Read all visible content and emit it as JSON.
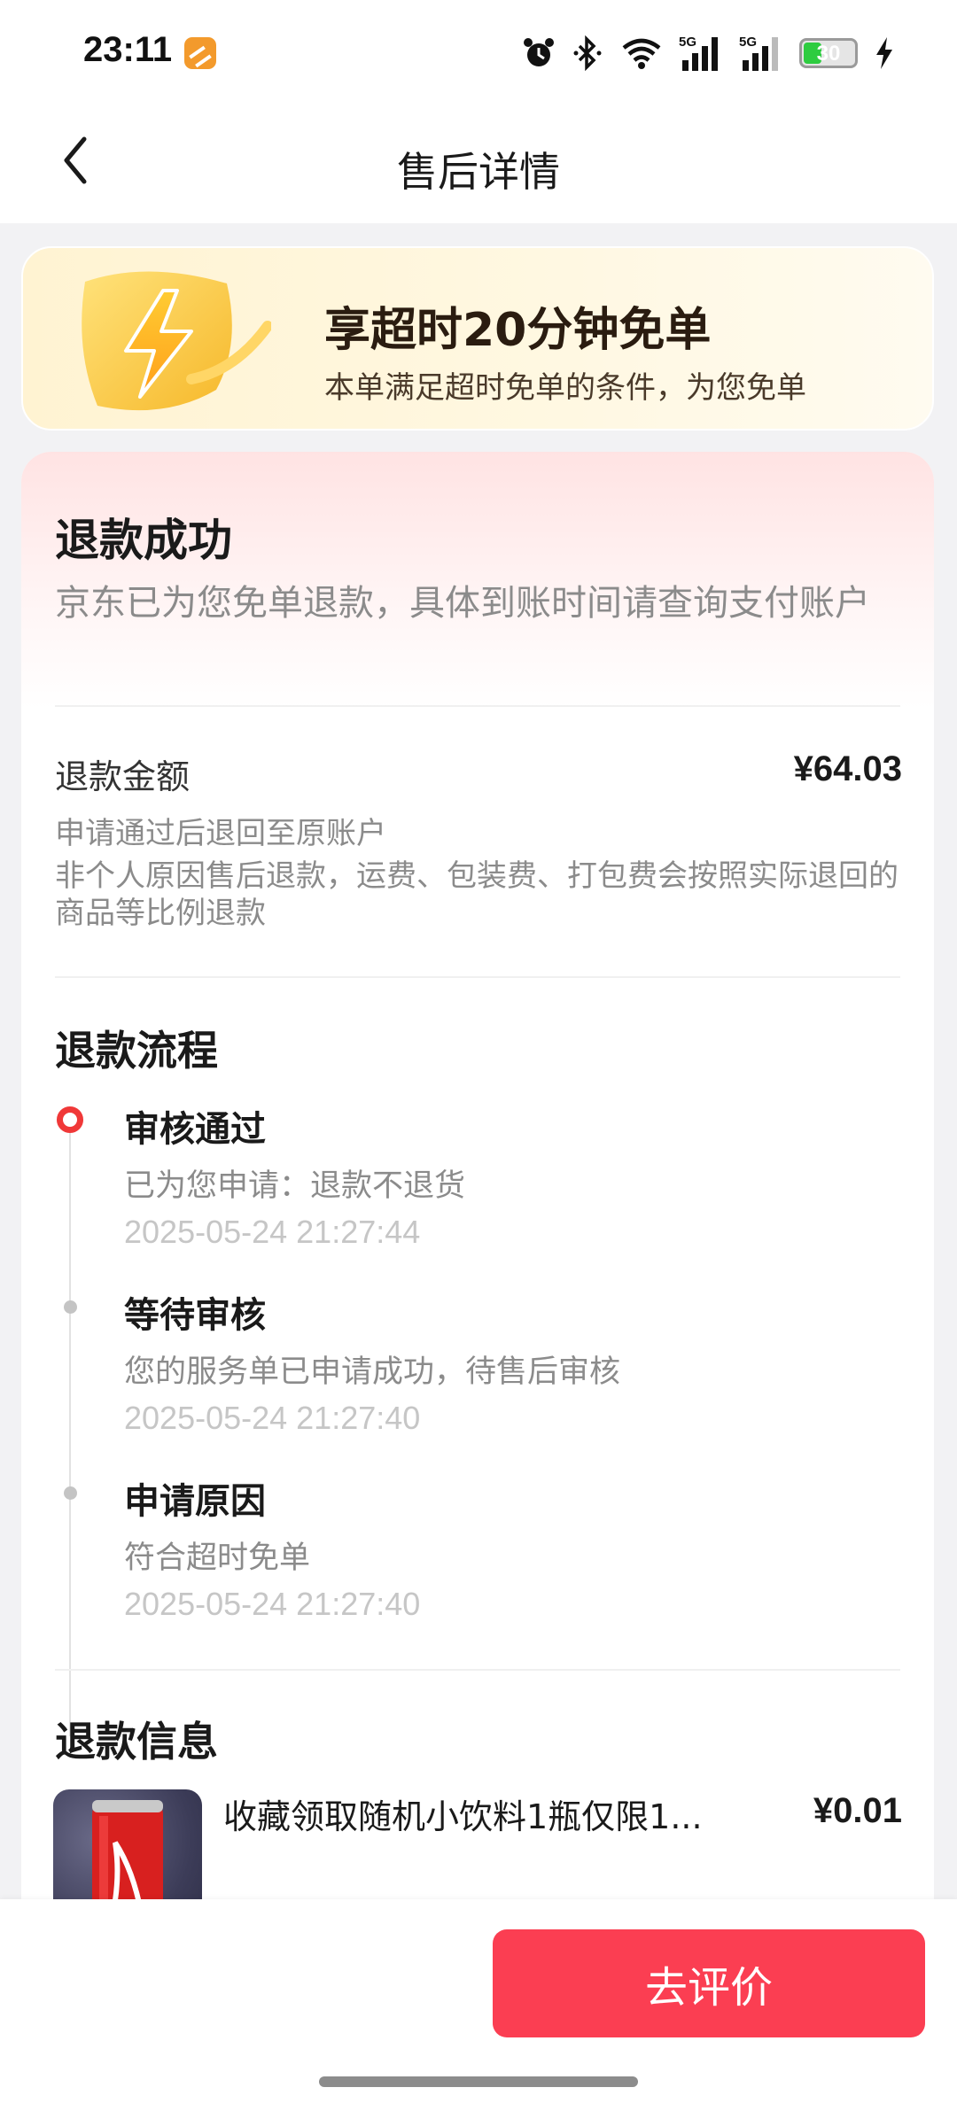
{
  "status_bar": {
    "time": "23:11",
    "battery_level": "30",
    "icons": [
      "app-badge-icon",
      "alarm-icon",
      "bluetooth-icon",
      "wifi-icon",
      "signal-5g-icon",
      "signal-5g-icon-2",
      "battery-icon",
      "charging-icon"
    ]
  },
  "nav": {
    "title": "售后详情",
    "back_icon": "chevron-left-icon"
  },
  "promo": {
    "title": "享超时20分钟免单",
    "subtitle": "本单满足超时免单的条件，为您免单",
    "icon": "lightning-shield-icon"
  },
  "refund": {
    "status_title": "退款成功",
    "status_desc": "京东已为您免单退款，具体到账时间请查询支付账户",
    "amount_label": "退款金额",
    "amount_value": "¥64.03",
    "note_1": "申请通过后退回至原账户",
    "note_2": "非个人原因售后退款，运费、包装费、打包费会按照实际退回的商品等比例退款"
  },
  "process": {
    "title": "退款流程",
    "steps": [
      {
        "title": "审核通过",
        "desc": "已为您申请：退款不退货",
        "time": "2025-05-24 21:27:44"
      },
      {
        "title": "等待审核",
        "desc": "您的服务单已申请成功，待售后审核",
        "time": "2025-05-24 21:27:40"
      },
      {
        "title": "申请原因",
        "desc": "符合超时免单",
        "time": "2025-05-24 21:27:40"
      }
    ]
  },
  "refund_info": {
    "title": "退款信息",
    "product_name": "收藏领取随机小饮料1瓶仅限1...",
    "product_price": "¥0.01"
  },
  "bottom": {
    "review_button": "去评价"
  },
  "colors": {
    "accent_red": "#fb3e52",
    "timeline_active": "#f03838",
    "promo_bg": "#fff3d2",
    "header_gradient": "#ffe3e3"
  }
}
